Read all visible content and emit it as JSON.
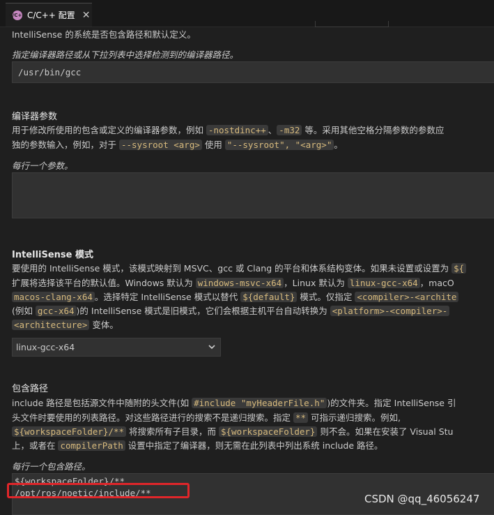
{
  "tab": {
    "icon_text": "C/C++",
    "label": "C/C++ 配置",
    "close": "✕"
  },
  "compiler": {
    "desc_tail": "IntelliSense 的系统是否包含路径和默认定义。",
    "hint": "指定编译器路径或从下拉列表中选择检测到的编译器路径。",
    "value": "/usr/bin/gcc"
  },
  "compiler_args": {
    "title": "编译器参数",
    "line1_a": "用于修改所使用的包含或定义的编译器参数，例如 ",
    "line1_code1": "-nostdinc++",
    "line1_b": "、",
    "line1_code2": "-m32",
    "line1_c": " 等。采用其他空格分隔参数的参数应",
    "line2_a": "独的参数输入，例如，对于 ",
    "line2_code1": "--sysroot <arg>",
    "line2_b": " 使用 ",
    "line2_code2": "\"--sysroot\", \"<arg>\"",
    "line2_c": "。",
    "hint": "每行一个参数。"
  },
  "intellisense": {
    "title": "IntelliSense 模式",
    "line1_a": "要使用的 IntelliSense 模式，该模式映射到 MSVC、gcc 或 Clang 的平台和体系结构变体。如果未设置或设置为 ",
    "line1_code": "${",
    "line2_a": "扩展将选择该平台的默认值。Windows 默认为 ",
    "line2_code1": "windows-msvc-x64",
    "line2_b": "，Linux 默认为 ",
    "line2_code2": "linux-gcc-x64",
    "line2_c": "，macO",
    "line3_code1": "macos-clang-x64",
    "line3_a": "。选择特定 IntelliSense 模式以替代 ",
    "line3_code2": "${default}",
    "line3_b": " 模式。仅指定 ",
    "line3_code3": "<compiler>-<archite",
    "line4_a": "(例如 ",
    "line4_code1": "gcc-x64",
    "line4_b": ")的 IntelliSense 模式是旧模式，它们会根据主机平台自动转换为 ",
    "line4_code2": "<platform>-<compiler>-",
    "line5_code": "<architecture>",
    "line5_a": " 变体。",
    "selected": "linux-gcc-x64"
  },
  "include": {
    "title": "包含路径",
    "line1_a": "include 路径是包括源文件中随附的头文件(如 ",
    "line1_code": "#include \"myHeaderFile.h\"",
    "line1_b": ")的文件夹。指定 IntelliSense 引",
    "line2_a": "头文件时要使用的列表路径。对这些路径进行的搜索不是递归搜索。指定 ",
    "line2_code": "**",
    "line2_b": " 可指示递归搜索。例如,",
    "line3_code1": "${workspaceFolder}/**",
    "line3_a": " 将搜索所有子目录，而 ",
    "line3_code2": "${workspaceFolder}",
    "line3_b": " 则不会。如果在安装了 Visual Stu",
    "line4_a": "上，或者在 ",
    "line4_code": "compilerPath",
    "line4_b": " 设置中指定了编译器，则无需在此列表中列出系统 include 路径。",
    "hint": "每行一个包含路径。",
    "value_line1": "${workspaceFolder}/**",
    "value_line2": "/opt/ros/noetic/include/**"
  },
  "watermark": "CSDN @qq_46056247",
  "colors": {
    "highlight": "#e0262a",
    "code_text": "#d7ba7d"
  }
}
